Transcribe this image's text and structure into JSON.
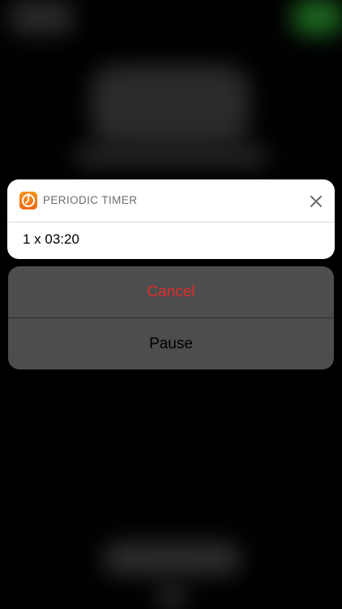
{
  "notification": {
    "app_name": "PERIODIC TIMER",
    "app_icon": "timer-app-icon",
    "body": "1 x 03:20",
    "close_icon": "close-icon"
  },
  "actions": {
    "cancel_label": "Cancel",
    "pause_label": "Pause"
  },
  "colors": {
    "accent_icon": "#f7941d",
    "cancel_text": "#e02a2a",
    "action_sheet_bg": "#4d4d4d"
  }
}
